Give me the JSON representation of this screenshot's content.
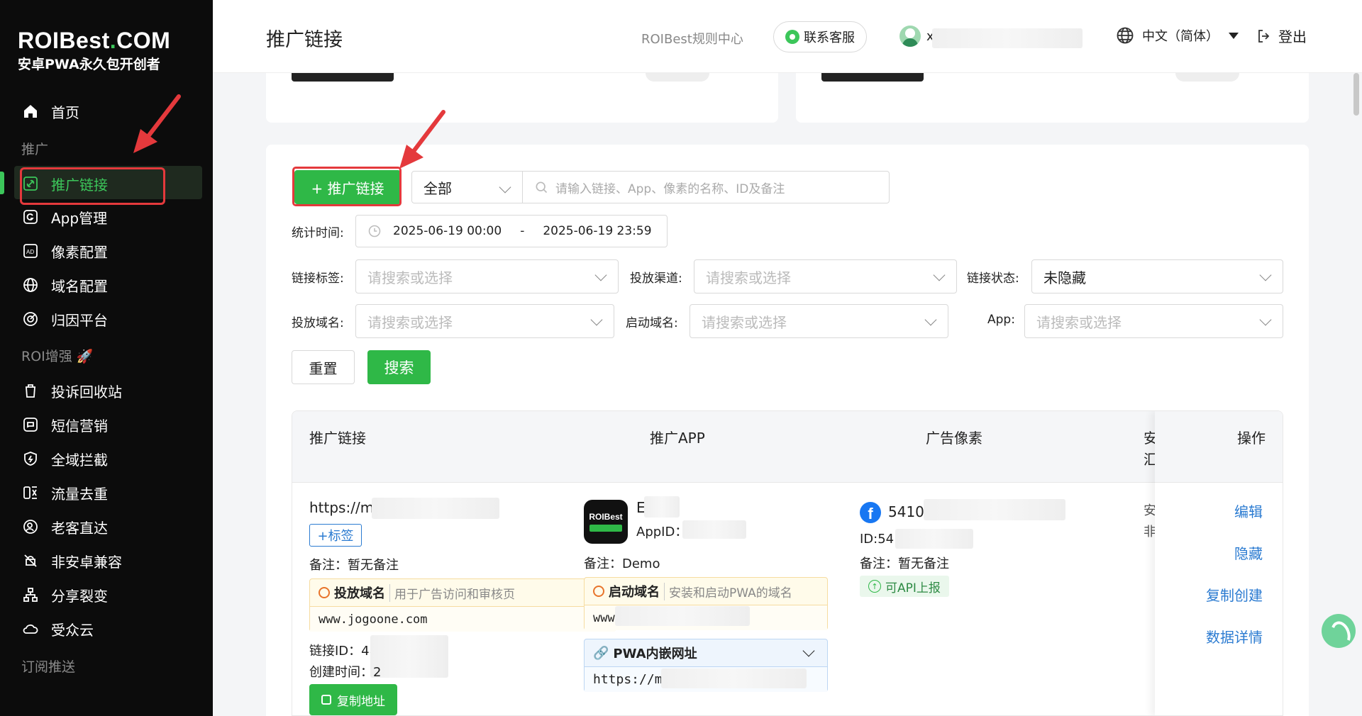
{
  "brand": {
    "name_part1": "ROIBest",
    "name_dot": ".",
    "name_part2": "COM",
    "tagline": "安卓PWA永久包开创者"
  },
  "sidebar": {
    "home": "首页",
    "group_promo": "推广",
    "items": [
      {
        "label": "推广链接",
        "icon": "link-icon"
      },
      {
        "label": "App管理",
        "icon": "app-icon"
      },
      {
        "label": "像素配置",
        "icon": "ad-icon"
      },
      {
        "label": "域名配置",
        "icon": "globe-icon"
      },
      {
        "label": "归因平台",
        "icon": "target-icon"
      }
    ],
    "group_roi": "ROI增强",
    "roi_emoji": "🚀",
    "roi_items": [
      {
        "label": "投诉回收站",
        "icon": "trash-icon"
      },
      {
        "label": "短信营销",
        "icon": "sms-icon"
      },
      {
        "label": "全域拦截",
        "icon": "shield-icon"
      },
      {
        "label": "流量去重",
        "icon": "dedupe-icon"
      },
      {
        "label": "老客直达",
        "icon": "user-target-icon"
      },
      {
        "label": "非安卓兼容",
        "icon": "android-off-icon"
      },
      {
        "label": "分享裂变",
        "icon": "share-tree-icon"
      },
      {
        "label": "受众云",
        "icon": "cloud-icon"
      }
    ],
    "group_sub": "订阅推送"
  },
  "header": {
    "title": "推广链接",
    "rules": "ROIBest规则中心",
    "support": "联系客服",
    "user_initial": "x",
    "language": "中文（简体）",
    "logout": "登出"
  },
  "toolbar": {
    "add_button": "+ 推广链接",
    "scope": "全部",
    "search_placeholder": "请输入链接、App、像素的名称、ID及备注"
  },
  "filters": {
    "time_label": "统计时间:",
    "date_start": "2025-06-19 00:00",
    "date_sep": "-",
    "date_end": "2025-06-19 23:59",
    "tag_label": "链接标签:",
    "tag_placeholder": "请搜索或选择",
    "channel_label": "投放渠道:",
    "channel_placeholder": "请搜索或选择",
    "status_label": "链接状态:",
    "status_value": "未隐藏",
    "domain_label": "投放域名:",
    "domain_placeholder": "请搜索或选择",
    "launch_label": "启动域名:",
    "launch_placeholder": "请搜索或选择",
    "app_label": "App:",
    "app_placeholder": "请搜索或选择",
    "reset": "重置",
    "search": "搜索"
  },
  "table": {
    "headers": {
      "link": "推广链接",
      "app": "推广APP",
      "pixel": "广告像素",
      "security": "安",
      "security2": "汇",
      "ops": "操作"
    },
    "row": {
      "url": "https://ma",
      "tag_button": "+标签",
      "remark": "备注：暂无备注",
      "domain_title": "投放域名",
      "domain_desc": "用于广告访问和审核页",
      "domain_value": "www.jogoone.com",
      "link_id": "链接ID：48",
      "created": "创建时间：2",
      "copy": "复制地址",
      "app_icon_text": "ROIBest",
      "app_name": "E",
      "app_id": "AppID：6",
      "app_remark": "备注：Demo",
      "launch_title": "启动域名",
      "launch_desc": "安装和启动PWA的域名",
      "launch_value": "www.",
      "pwa_title": "PWA内嵌网址",
      "pwa_value": "https://ma",
      "pixel_value": "5410",
      "pixel_id": "ID:54",
      "pixel_remark": "备注：暂无备注",
      "api_badge": "可API上报",
      "sec1": "安",
      "sec2": "非",
      "ops": [
        "编辑",
        "隐藏",
        "复制创建",
        "数据详情"
      ]
    }
  },
  "colors": {
    "brand_green": "#2fb847",
    "link_blue": "#2b7bd1",
    "annotation_red": "#e4393c"
  }
}
